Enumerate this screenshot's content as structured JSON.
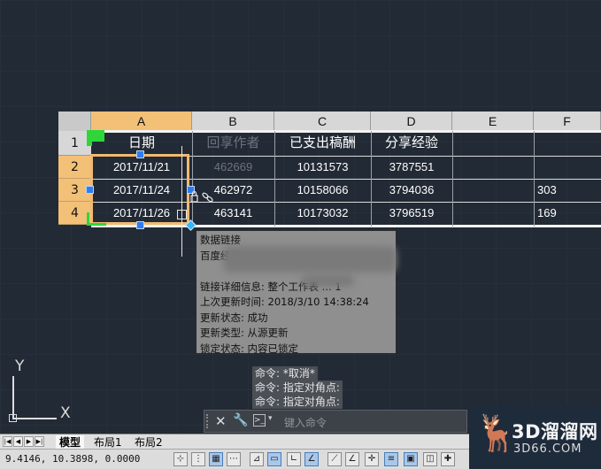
{
  "table": {
    "columns": [
      "A",
      "B",
      "C",
      "D",
      "E",
      "F"
    ],
    "rows": [
      "1",
      "2",
      "3",
      "4"
    ],
    "header": [
      "日期",
      "回享作者",
      "已支出稿酬",
      "分享经验"
    ],
    "data": [
      [
        "2017/11/21",
        "462669",
        "10131573",
        "3787551",
        "",
        ""
      ],
      [
        "2017/11/24",
        "462972",
        "10158066",
        "3794036",
        "",
        "303"
      ],
      [
        "2017/11/26",
        "463141",
        "10173032",
        "3796519",
        "",
        "169"
      ]
    ]
  },
  "popup": {
    "title": "数据链接",
    "line2": "百度经验",
    "detail": "链接详细信息: 整个工作表 ... 1",
    "last_update": "上次更新时间: 2018/3/10 14:38:24",
    "status": "更新状态: 成功",
    "type": "更新类型: 从源更新",
    "lock": "锁定状态: 内容已锁定"
  },
  "command_history": [
    "命令: *取消*",
    "命令: 指定对角点:",
    "命令: 指定对角点:"
  ],
  "command_line": {
    "placeholder": "键入命令"
  },
  "ucs": {
    "x": "X",
    "y": "Y"
  },
  "tabs": {
    "model": "模型",
    "layout1": "布局1",
    "layout2": "布局2"
  },
  "status": {
    "coords": "9.4146, 10.3898, 0.0000"
  },
  "watermark": {
    "brand": "3D溜溜网",
    "url": "3D66.COM"
  }
}
